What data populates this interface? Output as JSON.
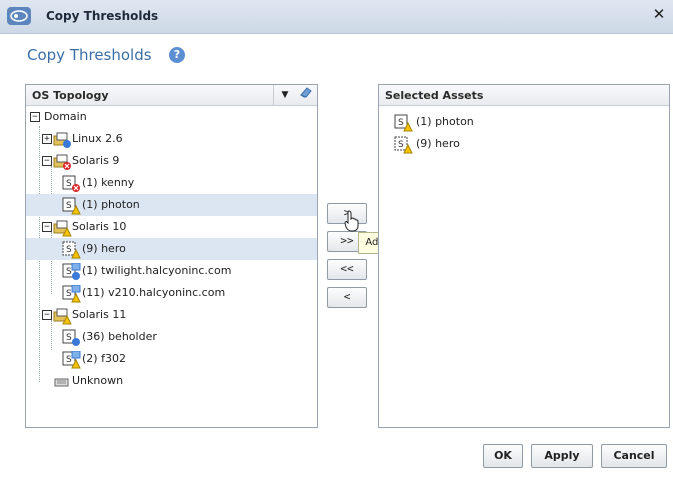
{
  "window": {
    "title": "Copy Thresholds"
  },
  "header": {
    "title": "Copy Thresholds"
  },
  "left_panel": {
    "dropdown_label": "OS Topology"
  },
  "tree": [
    {
      "label": "Domain"
    },
    {
      "label": "Linux 2.6"
    },
    {
      "label": "Solaris 9"
    },
    {
      "label": "(1) kenny"
    },
    {
      "label": "(1) photon"
    },
    {
      "label": "Solaris 10"
    },
    {
      "label": "(9) hero"
    },
    {
      "label": "(1) twilight.halcyoninc.com"
    },
    {
      "label": "(11) v210.halcyoninc.com"
    },
    {
      "label": "Solaris 11"
    },
    {
      "label": "(36) beholder"
    },
    {
      "label": "(2) f302"
    },
    {
      "label": "Unknown"
    }
  ],
  "transfer_buttons": {
    "add": ">",
    "add_all": ">>",
    "remove_all": "<<",
    "remove": "<"
  },
  "tooltip": "Add",
  "right_panel": {
    "title": "Selected Assets",
    "items": [
      {
        "label": "(1) photon"
      },
      {
        "label": "(9) hero"
      }
    ]
  },
  "footer": {
    "ok": "OK",
    "apply": "Apply",
    "cancel": "Cancel"
  },
  "colors": {
    "accent": "#3a6ea8",
    "selection": "#dce6f2",
    "warning": "#f5c400",
    "error": "#d9262b",
    "info": "#3b79d8"
  }
}
